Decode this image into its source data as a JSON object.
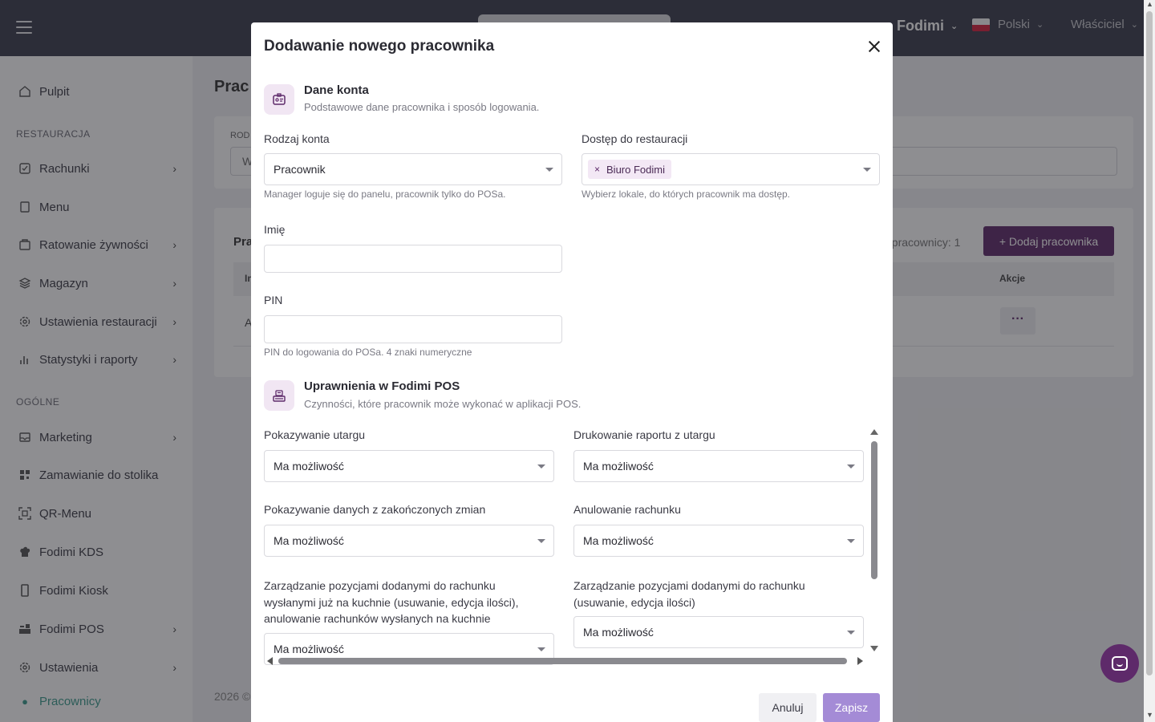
{
  "topbar": {
    "brand": "Fodimi",
    "language": "Polski",
    "role": "Właściciel"
  },
  "sidebar": {
    "items_top": [
      {
        "label": "Pulpit",
        "icon": "home-icon"
      }
    ],
    "section_restaurant": "RESTAURACJA",
    "items_restaurant": [
      {
        "label": "Rachunki",
        "icon": "receipt-icon"
      },
      {
        "label": "Menu",
        "icon": "book-icon"
      },
      {
        "label": "Ratowanie żywności",
        "icon": "bag-icon"
      },
      {
        "label": "Magazyn",
        "icon": "layers-icon"
      },
      {
        "label": "Ustawienia restauracji",
        "icon": "gear-icon"
      },
      {
        "label": "Statystyki i raporty",
        "icon": "chart-icon"
      }
    ],
    "section_general": "OGÓLNE",
    "items_general": [
      {
        "label": "Marketing",
        "icon": "envelope-icon"
      },
      {
        "label": "Zamawianie do stolika",
        "icon": "qr-icon"
      },
      {
        "label": "QR-Menu",
        "icon": "qr-scan-icon"
      },
      {
        "label": "Fodimi KDS",
        "icon": "chef-icon"
      },
      {
        "label": "Fodimi Kiosk",
        "icon": "kiosk-icon"
      },
      {
        "label": "Fodimi POS",
        "icon": "pos-icon"
      },
      {
        "label": "Ustawienia",
        "icon": "gear-icon"
      },
      {
        "label": "Pracownicy",
        "icon": "users-icon"
      }
    ]
  },
  "main": {
    "page_title": "Prac",
    "filter_label": "ROD",
    "filter_value": "W",
    "list_title": "Pra",
    "count_text": "ni pracownicy: 1",
    "add_button": "+ Dodaj pracownika",
    "col_first": "In",
    "col_actions": "Akcje",
    "row_first": "A",
    "footer": "2026 ©"
  },
  "modal": {
    "title": "Dodawanie nowego pracownika",
    "account_section": {
      "title": "Dane konta",
      "description": "Podstawowe dane pracownika i sposób logowania.",
      "icon": "id-card-icon"
    },
    "account_type": {
      "label": "Rodzaj konta",
      "value": "Pracownik",
      "hint": "Manager loguje się do panelu, pracownik tylko do POSa."
    },
    "restaurant_access": {
      "label": "Dostęp do restauracji",
      "tag": "Biuro Fodimi",
      "hint": "Wybierz lokale, do których pracownik ma dostęp."
    },
    "first_name": {
      "label": "Imię",
      "value": ""
    },
    "pin": {
      "label": "PIN",
      "value": "",
      "hint": "PIN do logowania do POSa. 4 znaki numeryczne"
    },
    "pos_section": {
      "title": "Uprawnienia w Fodimi POS",
      "description": "Czynności, które pracownik może wykonać w aplikacji POS.",
      "icon": "pos-terminal-icon"
    },
    "permissions": [
      {
        "label": "Pokazywanie utargu",
        "value": "Ma możliwość"
      },
      {
        "label": "Drukowanie raportu z utargu",
        "value": "Ma możliwość"
      },
      {
        "label": "Pokazywanie danych z zakończonych zmian",
        "value": "Ma możliwość"
      },
      {
        "label": "Anulowanie rachunku",
        "value": "Ma możliwość"
      },
      {
        "label": "Zarządzanie pozycjami dodanymi do rachunku wysłanymi już na kuchnie (usuwanie, edycja ilości), anulowanie rachunków wysłanych na kuchnie",
        "value": "Ma możliwość"
      },
      {
        "label": "Zarządzanie pozycjami dodanymi do rachunku (usuwanie, edycja ilości)",
        "value": "Ma możliwość"
      }
    ],
    "cancel_button": "Anuluj",
    "save_button": "Zapisz"
  },
  "colors": {
    "accent": "#5e2a6a",
    "save_button": "#a48bd6",
    "topbar": "#3a3d4c"
  }
}
